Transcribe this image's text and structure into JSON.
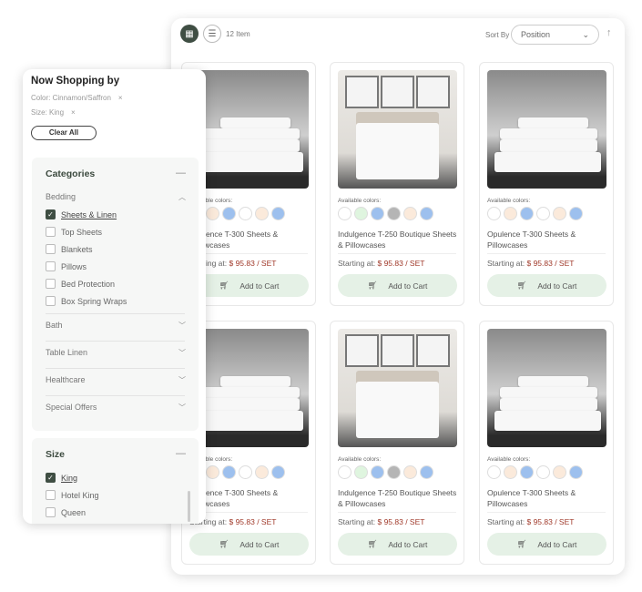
{
  "toolbar": {
    "item_count": "12 Item",
    "sort_label": "Sort By",
    "sort_value": "Position",
    "grid_icon": "grid-icon",
    "list_icon": "list-icon",
    "sort_direction_icon": "arrow-up-icon"
  },
  "products": [
    {
      "name": "Opulence T-300 Sheets & Pillowcases",
      "image": "stack",
      "colors": [
        "#ffffff",
        "#fbeadb",
        "#9dc0ee",
        "#ffffff",
        "#fbeadb",
        "#9dc0ee"
      ]
    },
    {
      "name": "Indulgence T-250 Boutique Sheets & Pillowcases",
      "image": "room",
      "colors": [
        "#ffffff",
        "#dff5df",
        "#9dc0ee",
        "#b5b5b5",
        "#fbeadb",
        "#9dc0ee"
      ]
    },
    {
      "name": "Opulence T-300 Sheets & Pillowcases",
      "image": "stack",
      "colors": [
        "#ffffff",
        "#fbeadb",
        "#9dc0ee",
        "#ffffff",
        "#fbeadb",
        "#9dc0ee"
      ]
    },
    {
      "name": "Opulence T-300 Sheets & Pillowcases",
      "image": "stack",
      "colors": [
        "#ffffff",
        "#fbeadb",
        "#9dc0ee",
        "#ffffff",
        "#fbeadb",
        "#9dc0ee"
      ]
    },
    {
      "name": "Indulgence T-250 Boutique Sheets & Pillowcases",
      "image": "room",
      "colors": [
        "#ffffff",
        "#dff5df",
        "#9dc0ee",
        "#b5b5b5",
        "#fbeadb",
        "#9dc0ee"
      ]
    },
    {
      "name": "Opulence T-300 Sheets & Pillowcases",
      "image": "stack",
      "colors": [
        "#ffffff",
        "#fbeadb",
        "#9dc0ee",
        "#ffffff",
        "#fbeadb",
        "#9dc0ee"
      ]
    }
  ],
  "card": {
    "available_label": "Available colors:",
    "price_label": "Starting at:",
    "price": "$ 95.83 / SET",
    "cart_label": "Add to Cart"
  },
  "sidebar": {
    "title": "Now Shopping by",
    "filters": [
      "Color: Cinnamon/Saffron",
      "Size: King"
    ],
    "clear_all": "Clear All",
    "categories": {
      "title": "Categories",
      "group": "Bedding",
      "options": [
        {
          "label": "Sheets & Linen",
          "checked": true
        },
        {
          "label": "Top Sheets",
          "checked": false
        },
        {
          "label": "Blankets",
          "checked": false
        },
        {
          "label": "Pillows",
          "checked": false
        },
        {
          "label": "Bed Protection",
          "checked": false
        },
        {
          "label": "Box Spring Wraps",
          "checked": false
        }
      ],
      "collapsed": [
        "Bath",
        "Table Linen",
        "Healthcare",
        "Special Offers"
      ]
    },
    "size": {
      "title": "Size",
      "options": [
        {
          "label": "King",
          "checked": true
        },
        {
          "label": "Hotel King",
          "checked": false
        },
        {
          "label": "Queen",
          "checked": false
        }
      ]
    }
  },
  "colors": {
    "accent": "#3f4e43",
    "price": "#a0392a",
    "cart_bg": "#e5f1e6"
  }
}
